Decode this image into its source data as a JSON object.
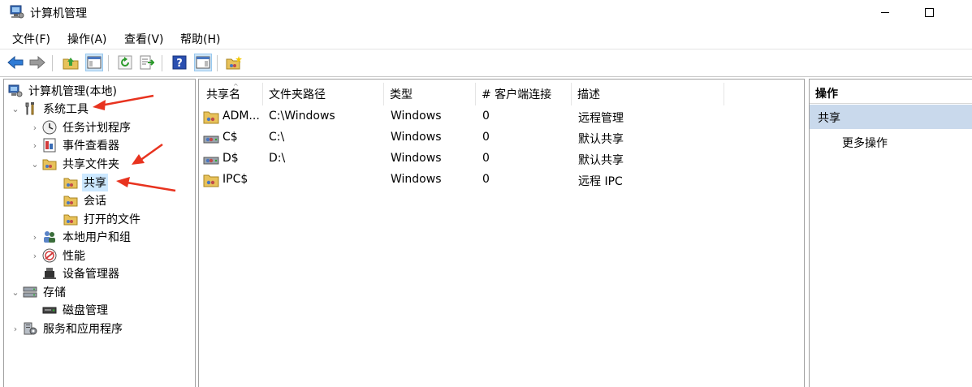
{
  "window": {
    "title": "计算机管理"
  },
  "menu": [
    "文件(F)",
    "操作(A)",
    "查看(V)",
    "帮助(H)"
  ],
  "toolbar": {
    "buttons": [
      "back-icon",
      "forward-icon",
      "up-folder-icon",
      "show-hide-tree-icon",
      "refresh-icon",
      "export-list-icon",
      "help-icon",
      "show-hide-action-pane-icon",
      "new-share-icon"
    ]
  },
  "tree": [
    {
      "label": "计算机管理(本地)",
      "icon": "computer-management-icon"
    },
    {
      "label": "系统工具",
      "icon": "tools-icon",
      "expanded": true
    },
    {
      "label": "任务计划程序",
      "icon": "clock-icon"
    },
    {
      "label": "事件查看器",
      "icon": "event-viewer-icon"
    },
    {
      "label": "共享文件夹",
      "icon": "shared-folder-icon",
      "expanded": true
    },
    {
      "label": "共享",
      "icon": "shared-folder-icon",
      "selected": true
    },
    {
      "label": "会话",
      "icon": "shared-folder-icon"
    },
    {
      "label": "打开的文件",
      "icon": "shared-folder-icon"
    },
    {
      "label": "本地用户和组",
      "icon": "users-icon"
    },
    {
      "label": "性能",
      "icon": "performance-icon"
    },
    {
      "label": "设备管理器",
      "icon": "device-manager-icon"
    },
    {
      "label": "存储",
      "icon": "storage-icon",
      "expanded": true
    },
    {
      "label": "磁盘管理",
      "icon": "disk-icon"
    },
    {
      "label": "服务和应用程序",
      "icon": "services-icon"
    }
  ],
  "list": {
    "columns": [
      "共享名",
      "文件夹路径",
      "类型",
      "# 客户端连接",
      "描述"
    ],
    "rows": [
      {
        "name": "ADM...",
        "path": "C:\\Windows",
        "type": "Windows",
        "clients": "0",
        "desc": "远程管理",
        "icon": "shared-folder-icon"
      },
      {
        "name": "C$",
        "path": "C:\\",
        "type": "Windows",
        "clients": "0",
        "desc": "默认共享",
        "icon": "shared-drive-icon"
      },
      {
        "name": "D$",
        "path": "D:\\",
        "type": "Windows",
        "clients": "0",
        "desc": "默认共享",
        "icon": "shared-drive-icon"
      },
      {
        "name": "IPC$",
        "path": "",
        "type": "Windows",
        "clients": "0",
        "desc": "远程 IPC",
        "icon": "shared-folder-icon"
      }
    ]
  },
  "actions": {
    "header": "操作",
    "section": "共享",
    "more": "更多操作"
  },
  "colors": {
    "selection": "#cce8ff",
    "action_section": "#c9d9ec",
    "annotation_arrow": "#e8331f"
  }
}
